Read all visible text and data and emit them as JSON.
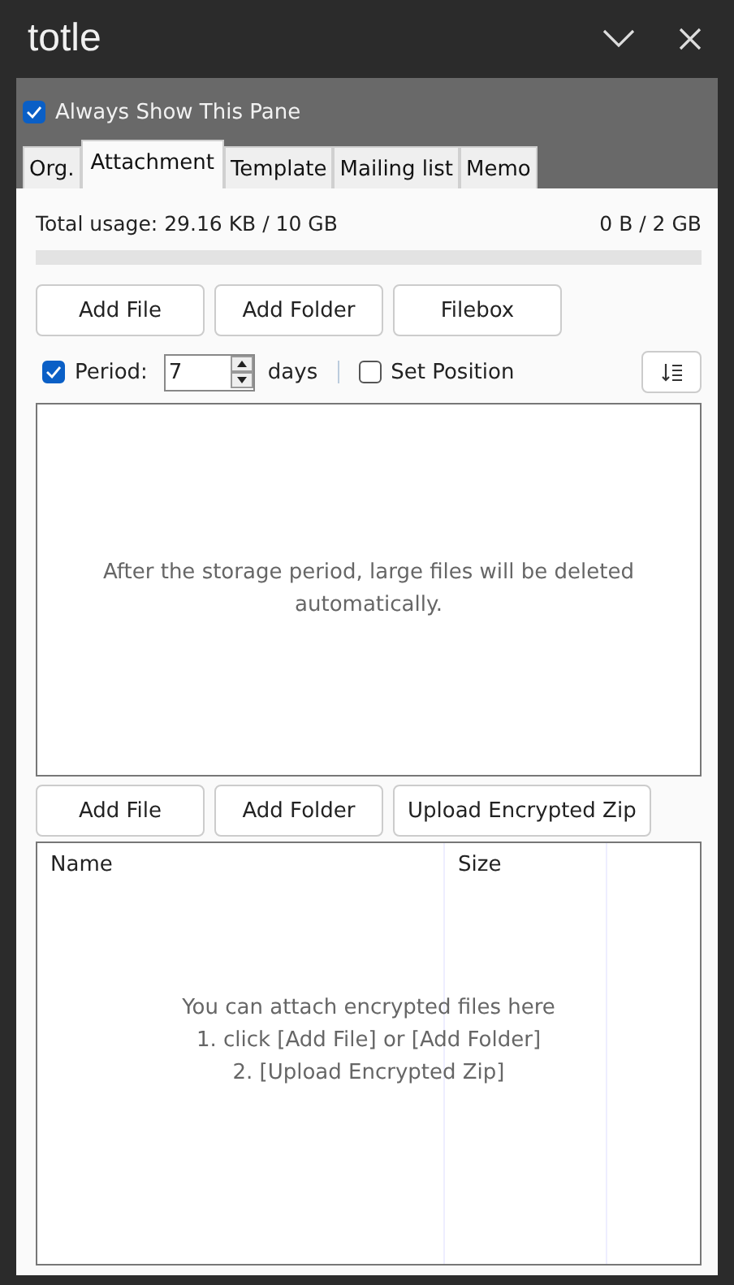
{
  "window": {
    "title": "totle",
    "buttons": [
      {
        "kind": "collapse"
      },
      {
        "kind": "close"
      }
    ]
  },
  "always_show": {
    "label": "Always Show This Pane",
    "checked": true
  },
  "tabs": [
    {
      "label": "Org.",
      "selected": false
    },
    {
      "label": "Attachment",
      "selected": true
    },
    {
      "label": "Template",
      "selected": false
    },
    {
      "label": "Mailing list",
      "selected": false
    },
    {
      "label": "Memo",
      "selected": false
    }
  ],
  "usage": {
    "total": "Total usage: 29.16 KB / 10 GB",
    "quota": "0 B / 2 GB"
  },
  "upload_buttons": [
    "Add File",
    "Add Folder",
    "Filebox"
  ],
  "period": {
    "checked": true,
    "label": "Period:",
    "value": "7",
    "unit": "days"
  },
  "set_position": {
    "label": "Set Position",
    "checked": false
  },
  "large_files": {
    "message": "After the storage period, large files will be deleted automatically."
  },
  "encrypted_buttons": [
    "Add File",
    "Add Folder",
    "Upload Encrypted Zip"
  ],
  "table": {
    "columns": [
      "Name",
      "Size"
    ],
    "empty_lines": [
      "You can attach encrypted files here",
      "1. click [Add File] or [Add Folder]",
      "2. [Upload Encrypted Zip]"
    ]
  }
}
